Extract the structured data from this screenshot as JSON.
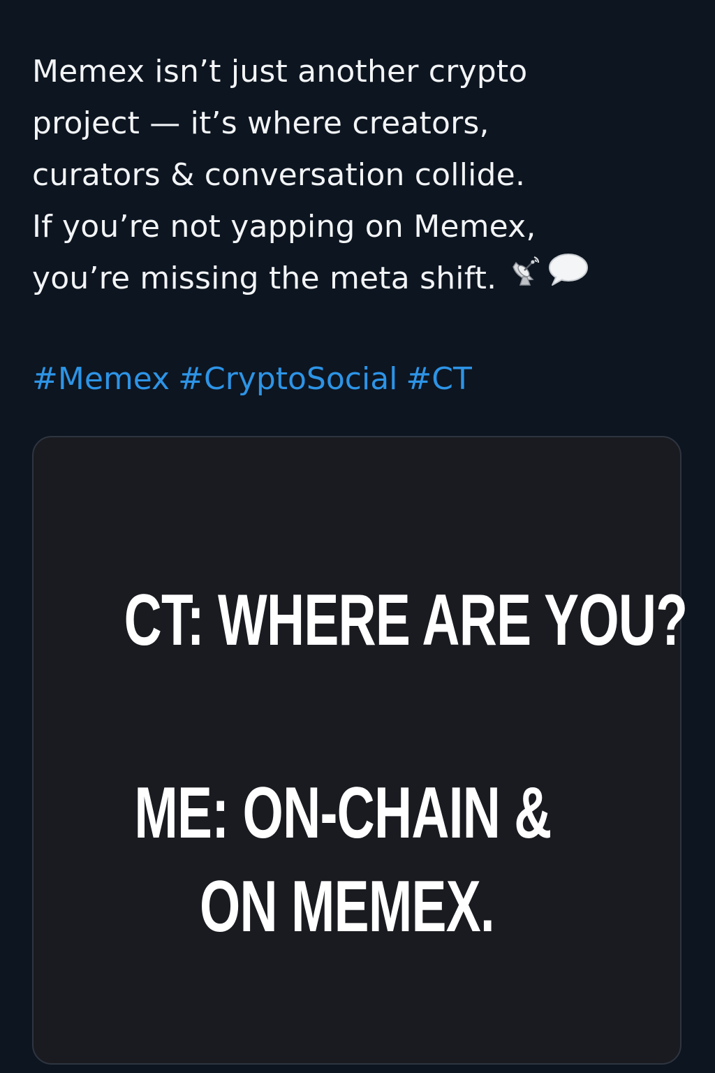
{
  "post": {
    "lines": [
      "Memex isn’t just another crypto",
      "project — it’s where creators,",
      "curators & conversation collide.",
      "If you’re not yapping on Memex,",
      "you’re missing the meta shift."
    ],
    "hashtags": [
      "#Memex",
      "#CryptoSocial",
      "#CT"
    ],
    "emojis": [
      "satellite-antenna-emoji",
      "speech-bubble-emoji"
    ]
  },
  "media": {
    "meme_lines": [
      "CT: WHERE ARE YOU?",
      "ME: ON-CHAIN &",
      "ON MEMEX."
    ]
  },
  "colors": {
    "background": "#0d1520",
    "text": "#f2f4f6",
    "hashtag": "#2d94e6",
    "card_background": "#1a1b20",
    "card_border": "#2e3540"
  }
}
